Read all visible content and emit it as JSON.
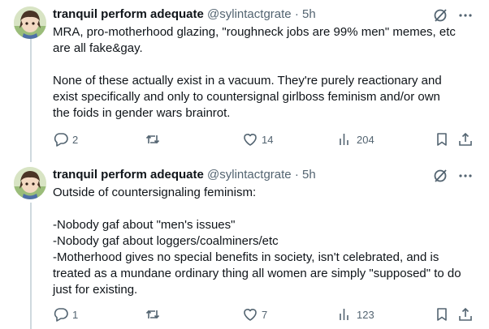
{
  "tweets": [
    {
      "author_name": "tranquil perform adequate",
      "handle": "@sylintactgrate",
      "separator": "·",
      "time": "5h",
      "lines": [
        "MRA, pro-motherhood glazing, \"roughneck jobs are 99% men\" memes, etc",
        "are all fake&gay.",
        "",
        "None of these actually exist in a vacuum. They're purely reactionary and",
        "exist specifically and only to countersignal girlboss feminism and/or own",
        "the foids in gender wars brainrot."
      ],
      "replies": "2",
      "retweets": "",
      "likes": "14",
      "views": "204"
    },
    {
      "author_name": "tranquil perform adequate",
      "handle": "@sylintactgrate",
      "separator": "·",
      "time": "5h",
      "lines": [
        "Outside of countersignaling feminism:",
        "",
        "-Nobody gaf about \"men's issues\"",
        "-Nobody gaf about loggers/coalminers/etc",
        "-Motherhood gives no special benefits in society, isn't celebrated, and is",
        "treated as a mundane ordinary thing all women are simply \"supposed\" to do",
        "just for existing."
      ],
      "replies": "1",
      "retweets": "",
      "likes": "7",
      "views": "123"
    }
  ],
  "icons": {
    "grok": "grok-slash-icon",
    "more": "more-icon",
    "reply": "reply-icon",
    "retweet": "retweet-icon",
    "like": "heart-icon",
    "views": "views-icon",
    "bookmark": "bookmark-icon",
    "share": "share-icon"
  },
  "colors": {
    "text": "#0f1419",
    "secondary": "#536471",
    "thread_line": "#cfd9de"
  }
}
